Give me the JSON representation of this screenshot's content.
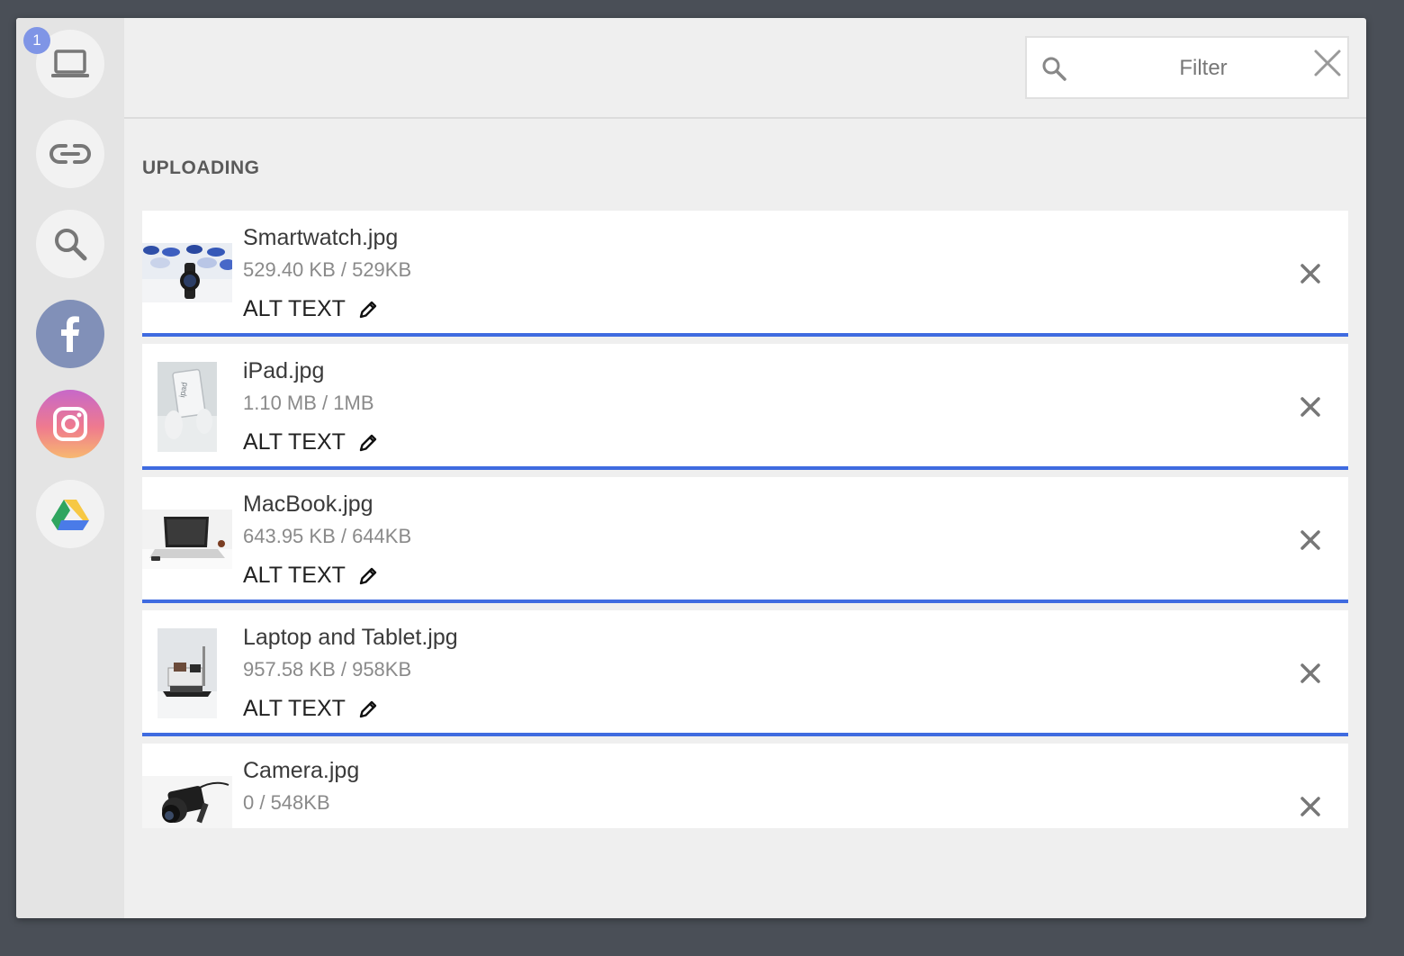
{
  "sidebar": {
    "badge_count": "1",
    "sources": [
      {
        "name": "computer",
        "icon": "laptop-icon"
      },
      {
        "name": "link",
        "icon": "link-icon"
      },
      {
        "name": "image-search",
        "icon": "search-icon"
      },
      {
        "name": "facebook",
        "icon": "facebook-icon",
        "color": "#8190b8"
      },
      {
        "name": "instagram",
        "icon": "instagram-icon"
      },
      {
        "name": "google-drive",
        "icon": "google-drive-icon"
      }
    ]
  },
  "header": {
    "filter": {
      "placeholder": "Filter",
      "value": ""
    }
  },
  "section": {
    "title": "UPLOADING"
  },
  "accent_color": "#3f6be0",
  "files": [
    {
      "name": "Smartwatch.jpg",
      "size": "529.40 KB / 529KB",
      "alt_label": "ALT TEXT",
      "thumb_icon": "smartwatch-photo"
    },
    {
      "name": "iPad.jpg",
      "size": "1.10 MB / 1MB",
      "alt_label": "ALT TEXT",
      "thumb_icon": "ipad-photo"
    },
    {
      "name": "MacBook.jpg",
      "size": "643.95 KB / 644KB",
      "alt_label": "ALT TEXT",
      "thumb_icon": "macbook-photo"
    },
    {
      "name": "Laptop and Tablet.jpg",
      "size": "957.58 KB / 958KB",
      "alt_label": "ALT TEXT",
      "thumb_icon": "laptop-tablet-photo"
    },
    {
      "name": "Camera.jpg",
      "size": "0 / 548KB",
      "thumb_icon": "camera-photo"
    }
  ]
}
